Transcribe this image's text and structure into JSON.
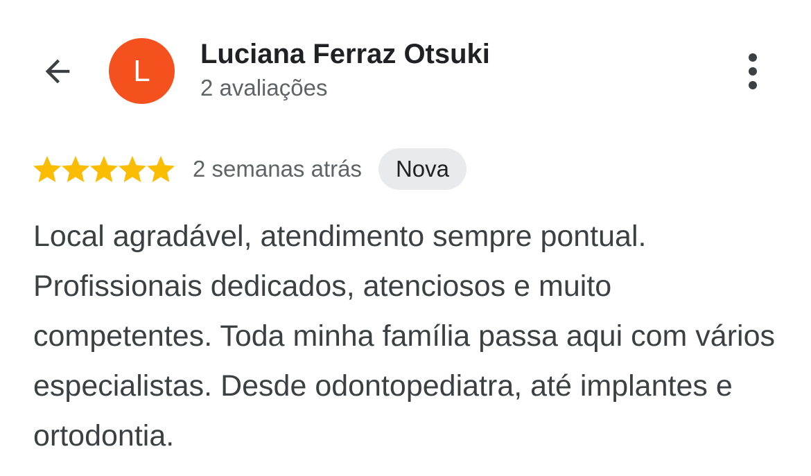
{
  "header": {
    "back_icon": "arrow-left-icon",
    "more_icon": "more-vertical-icon"
  },
  "reviewer": {
    "avatar_initial": "L",
    "avatar_color": "#f4511e",
    "name": "Luciana Ferraz Otsuki",
    "review_count": "2 avaliações"
  },
  "review": {
    "rating": 5,
    "max_rating": 5,
    "star_color": "#fbbc04",
    "date": "2 semanas atrás",
    "badge": "Nova",
    "text": "Local agradável, atendimento sempre pontual. Profissionais dedicados, atenciosos e muito competentes. Toda minha família passa aqui com vários especialistas. Desde odontopediatra, até implantes e ortodontia."
  }
}
